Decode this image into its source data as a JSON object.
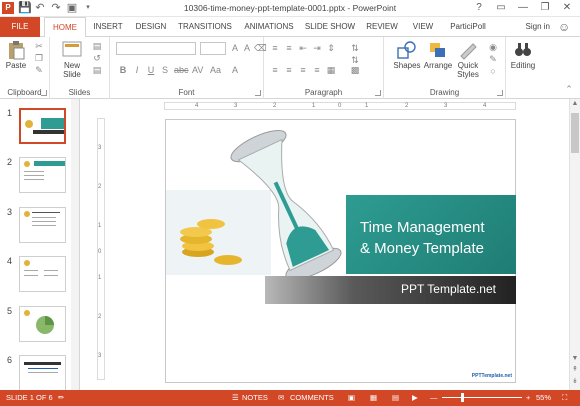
{
  "window": {
    "title": "10306-time-money-ppt-template-0001.pptx - PowerPoint",
    "controls": [
      "?",
      "▭",
      "—",
      "❐",
      "✕"
    ]
  },
  "quick_access": {
    "icons": [
      "powerpoint-icon",
      "save-icon",
      "undo-icon",
      "redo-icon",
      "start-slideshow-icon",
      "customize-icon"
    ]
  },
  "tabs": {
    "file": "FILE",
    "items": [
      "HOME",
      "INSERT",
      "DESIGN",
      "TRANSITIONS",
      "ANIMATIONS",
      "SLIDE SHOW",
      "REVIEW",
      "VIEW",
      "ParticiPoll"
    ],
    "active": "HOME",
    "signin": "Sign in"
  },
  "ribbon": {
    "clipboard": {
      "label": "Clipboard",
      "paste": "Paste"
    },
    "slides": {
      "label": "Slides",
      "new_slide": "New",
      "new_slide2": "Slide"
    },
    "font": {
      "label": "Font"
    },
    "paragraph": {
      "label": "Paragraph"
    },
    "drawing": {
      "label": "Drawing",
      "shapes": "Shapes",
      "arrange": "Arrange",
      "quick_styles": "Quick",
      "quick_styles2": "Styles"
    },
    "editing": {
      "label": "Editing",
      "editing": "Editing"
    }
  },
  "thumbnails": {
    "numbers": [
      "1",
      "2",
      "3",
      "4",
      "5",
      "6"
    ],
    "selected": "1"
  },
  "slide": {
    "title_line1": "Time Management",
    "title_line2": "& Money Template",
    "subtitle": "PPT Template.net",
    "footer": "PPTTemplate.net",
    "colors": {
      "teal": "#2e9c92",
      "dark": "#222222",
      "accent": "#d24726"
    }
  },
  "ruler": {
    "h_ticks": [
      "4",
      "3",
      "2",
      "1",
      "0",
      "1",
      "2",
      "3",
      "4"
    ],
    "v_ticks": [
      "3",
      "2",
      "1",
      "0",
      "1",
      "2",
      "3"
    ]
  },
  "statusbar": {
    "slide_info": "SLIDE 1 OF 6",
    "notes": "NOTES",
    "comments": "COMMENTS",
    "zoom": "55%",
    "zoom_level": 0.55
  }
}
